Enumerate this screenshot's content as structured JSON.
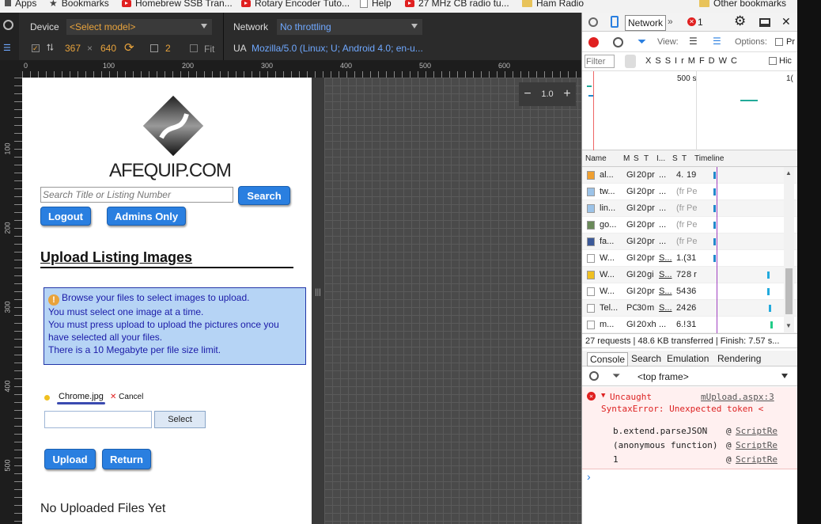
{
  "bookmarks": [
    "Apps",
    "Bookmarks",
    "Homebrew SSB Tran...",
    "Rotary Encoder Tuto...",
    "Help",
    "27 MHz CB radio tu...",
    "Ham Radio",
    "Other bookmarks"
  ],
  "device_toolbar": {
    "device_label": "Device",
    "device_value": "<Select model>",
    "network_label": "Network",
    "network_value": "No throttling",
    "width": "367",
    "times": "×",
    "height": "640",
    "scale": "2",
    "fit_label": "Fit",
    "ua_label": "UA",
    "ua_value": "Mozilla/5.0 (Linux; U; Android 4.0; en-u..."
  },
  "ruler_h": [
    "0",
    "100",
    "200",
    "300",
    "400",
    "500",
    "600"
  ],
  "ruler_v": [
    "100",
    "200",
    "300",
    "400",
    "500"
  ],
  "zoom": {
    "minus": "−",
    "value": "1.0",
    "plus": "+"
  },
  "page": {
    "logo_text": "AFEQUIP.COM",
    "search_placeholder": "Search Title or Listing Number",
    "search_btn": "Search",
    "logout_btn": "Logout",
    "admins_btn": "Admins Only",
    "heading": "Upload Listing Images",
    "info_lines": [
      "Browse your files to select images to upload.",
      "You must select one image at a time.",
      "You must press upload to upload the pictures once you have selected all your files.",
      "There is a 10 Megabyte per file size limit."
    ],
    "file_name": "Chrome.jpg",
    "cancel": "Cancel",
    "select_btn": "Select",
    "upload_btn": "Upload",
    "return_btn": "Return",
    "footer_text": "No Uploaded Files Yet"
  },
  "devtools": {
    "tabs": [
      "Network",
      "1"
    ],
    "view_label": "View:",
    "options_label": "Options:",
    "options_trail": "Pr",
    "filter_placeholder": "Filter",
    "filter_types": [
      "X",
      "S",
      "S",
      "Ir",
      "M",
      "F",
      "D",
      "W",
      "C"
    ],
    "hide_label": "Hic",
    "overview_time": "500 s",
    "overview_trail": "1(",
    "columns": [
      "Name",
      "M",
      "S",
      "T",
      "I...",
      "S",
      "T",
      "Timeline"
    ],
    "rows": [
      {
        "name": "al...",
        "m": "GI",
        "s": "20",
        "t": "pr",
        "i": "...",
        "sz": "4.",
        "tm": "19"
      },
      {
        "name": "tw...",
        "m": "GI",
        "s": "20",
        "t": "pr",
        "i": "...",
        "sz": "(fr",
        "tm": "Pe"
      },
      {
        "name": "lin...",
        "m": "GI",
        "s": "20",
        "t": "pr",
        "i": "...",
        "sz": "(fr",
        "tm": "Pe"
      },
      {
        "name": "go...",
        "m": "GI",
        "s": "20",
        "t": "pr",
        "i": "...",
        "sz": "(fr",
        "tm": "Pe"
      },
      {
        "name": "fa...",
        "m": "GI",
        "s": "20",
        "t": "pr",
        "i": "...",
        "sz": "(fr",
        "tm": "Pe"
      },
      {
        "name": "W...",
        "m": "GI",
        "s": "20",
        "t": "pr",
        "i": "S...",
        "sz": "1.(",
        "tm": "31"
      },
      {
        "name": "W...",
        "m": "GI",
        "s": "20",
        "t": "gi",
        "i": "S...",
        "sz": "72",
        "tm": "8 r"
      },
      {
        "name": "W...",
        "m": "GI",
        "s": "20",
        "t": "pr",
        "i": "S...",
        "sz": "54",
        "tm": "36"
      },
      {
        "name": "Tel...",
        "m": "PC",
        "s": "30",
        "t": "m",
        "i": "S...",
        "sz": "24",
        "tm": "26"
      },
      {
        "name": "m...",
        "m": "GI",
        "s": "20",
        "t": "xh",
        "i": "...",
        "sz": "6.!",
        "tm": "31"
      }
    ],
    "summary": "27 requests | 48.6 KB transferred | Finish: 7.57 s...",
    "drawer_tabs": [
      "Console",
      "Search",
      "Emulation",
      "Rendering"
    ],
    "frame": "<top frame>",
    "error": {
      "title": "Uncaught",
      "source": "mUpload.aspx:3",
      "message": "SyntaxError: Unexpected token <",
      "stack": [
        {
          "fn": "b.extend.parseJSON",
          "at": "@",
          "link": "ScriptRe"
        },
        {
          "fn": "(anonymous function)",
          "at": "@",
          "link": "ScriptRe"
        },
        {
          "fn": "1",
          "at": "@",
          "link": "ScriptRe"
        }
      ]
    },
    "prompt": "›"
  }
}
